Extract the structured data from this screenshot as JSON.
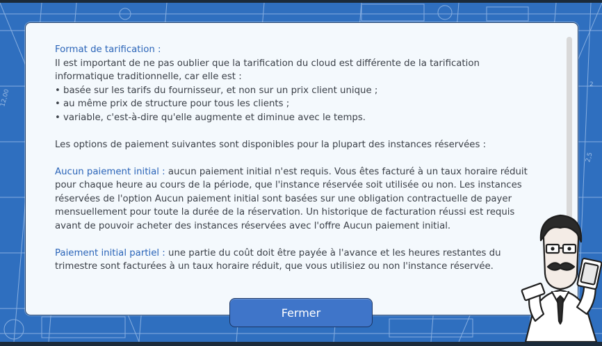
{
  "dialog": {
    "section_title": "Format de tarification :",
    "intro": "Il est important de ne pas oublier que la tarification du cloud est différente de la tarification informatique traditionnelle, car elle est :",
    "bullets": [
      "basée sur les tarifs du fournisseur, et non sur un prix client unique ;",
      "au même prix de structure pour tous les clients ;",
      "variable, c'est-à-dire qu'elle augmente et diminue avec le temps."
    ],
    "options_intro": "Les options de paiement suivantes sont disponibles pour la plupart des instances réservées :",
    "option1_title": "Aucun paiement initial :",
    "option1_text": " aucun paiement initial n'est requis. Vous êtes facturé à un taux horaire réduit pour chaque heure au cours de la période, que l'instance réservée soit utilisée ou non. Les instances réservées de l'option Aucun paiement initial sont basées sur une obligation contractuelle de payer mensuellement pour toute la durée de la réservation. Un historique de facturation réussi est requis avant de pouvoir acheter des instances réservées avec l'offre Aucun paiement initial.",
    "option2_title": "Paiement initial partiel :",
    "option2_text": " une partie du coût doit être payée à l'avance et les heures restantes du trimestre sont facturées à un taux horaire réduit, que vous utilisiez ou non l'instance réservée.",
    "close_label": "Fermer"
  },
  "icons": {
    "background": "blueprint-background",
    "character": "businessman-with-money-character"
  },
  "colors": {
    "background_blue": "#2f6fbf",
    "heading_blue": "#2a64b8",
    "button_blue": "#3f75c9",
    "panel_bg": "#f4f9fd",
    "text": "#3a3f47"
  }
}
